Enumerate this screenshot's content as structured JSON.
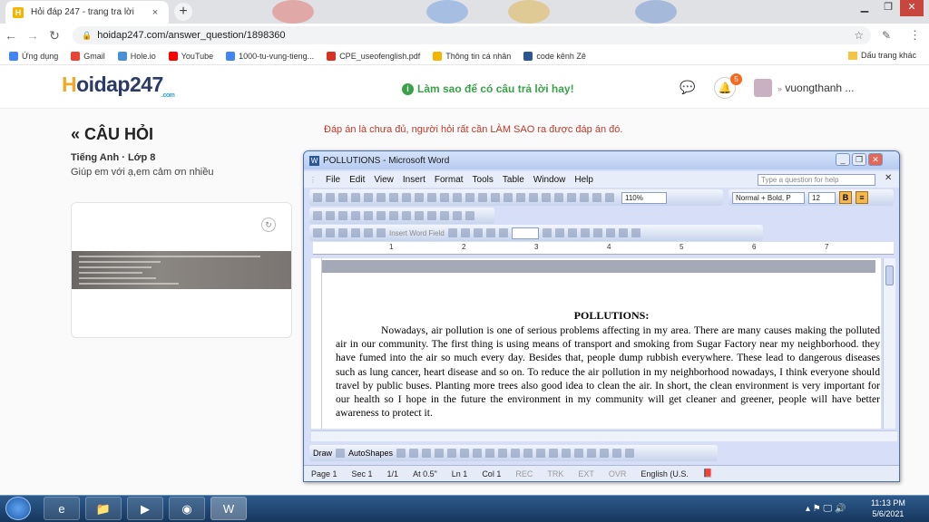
{
  "browser": {
    "tab_title": "Hỏi đáp 247 - trang tra lời",
    "tab_close": "×",
    "new_tab": "+",
    "url": "hoidap247.com/answer_question/1898360",
    "bookmarks": [
      {
        "label": "Ứng dụng",
        "color": "#4285f4"
      },
      {
        "label": "Gmail",
        "color": "#ea4335"
      },
      {
        "label": "Hole.io",
        "color": "#4a90d9"
      },
      {
        "label": "YouTube",
        "color": "#ff0000"
      },
      {
        "label": "1000-tu-vung-tieng...",
        "color": "#4285f4"
      },
      {
        "label": "CPE_useofenglish.pdf",
        "color": "#d93025"
      },
      {
        "label": "Thông tin cá nhân",
        "color": "#f4b400"
      },
      {
        "label": "code kênh Zê",
        "color": "#2b5797"
      }
    ],
    "other_bookmarks": "Dấu trang khác"
  },
  "site": {
    "logo_prefix": "H",
    "logo_rest": "oidap247",
    "logo_com": ".com",
    "tip": "Làm sao để có câu trả lời hay!",
    "notification_count": "5",
    "username": "vuongthanh ..."
  },
  "question": {
    "heading": "CÂU HỎI",
    "subject": "Tiếng Anh · Lớp 8",
    "text": "Giúp em với ạ,em cảm ơn nhiều",
    "notice": "Đáp án là chưa đủ, người hỏi rất cần LÀM SAO ra được đáp án đó."
  },
  "word": {
    "window_title": "POLLUTIONS - Microsoft Word",
    "menu": [
      "File",
      "Edit",
      "View",
      "Insert",
      "Format",
      "Tools",
      "Table",
      "Window",
      "Help"
    ],
    "help_placeholder": "Type a question for help",
    "zoom": "110%",
    "style": "Normal + Bold, P",
    "font_size": "12",
    "insert_word_field": "Insert Word Field",
    "draw_label": "Draw",
    "autoshapes_label": "AutoShapes",
    "doc_title": "POLLUTIONS:",
    "doc_body": "Nowadays, air pollution is one of serious problems affecting in my area. There are many causes making the polluted air in our community. The first thing is using means of transport and smoking from Sugar Factory near my neighborhood. they have fumed into the air so much every day. Besides that, people dump rubbish everywhere. These lead to dangerous diseases such as lung cancer, heart disease and so on. To reduce the air pollution in my neighborhood nowadays, I think everyone should travel by public buses. Planting more trees also good idea to clean the air. In short, the clean environment is very important for our health so I hope in the future the environment in my community will get cleaner and greener, people will have better awareness to protect it.",
    "status": {
      "page": "Page 1",
      "sec": "Sec 1",
      "pages": "1/1",
      "at": "At 0.5\"",
      "ln": "Ln 1",
      "col": "Col 1",
      "rec": "REC",
      "trk": "TRK",
      "ext": "EXT",
      "ovr": "OVR",
      "lang": "English (U.S."
    },
    "ruler_numbers": [
      "1",
      "2",
      "3",
      "4",
      "5",
      "6",
      "7"
    ]
  },
  "taskbar": {
    "time": "11:13 PM",
    "date": "5/6/2021"
  }
}
